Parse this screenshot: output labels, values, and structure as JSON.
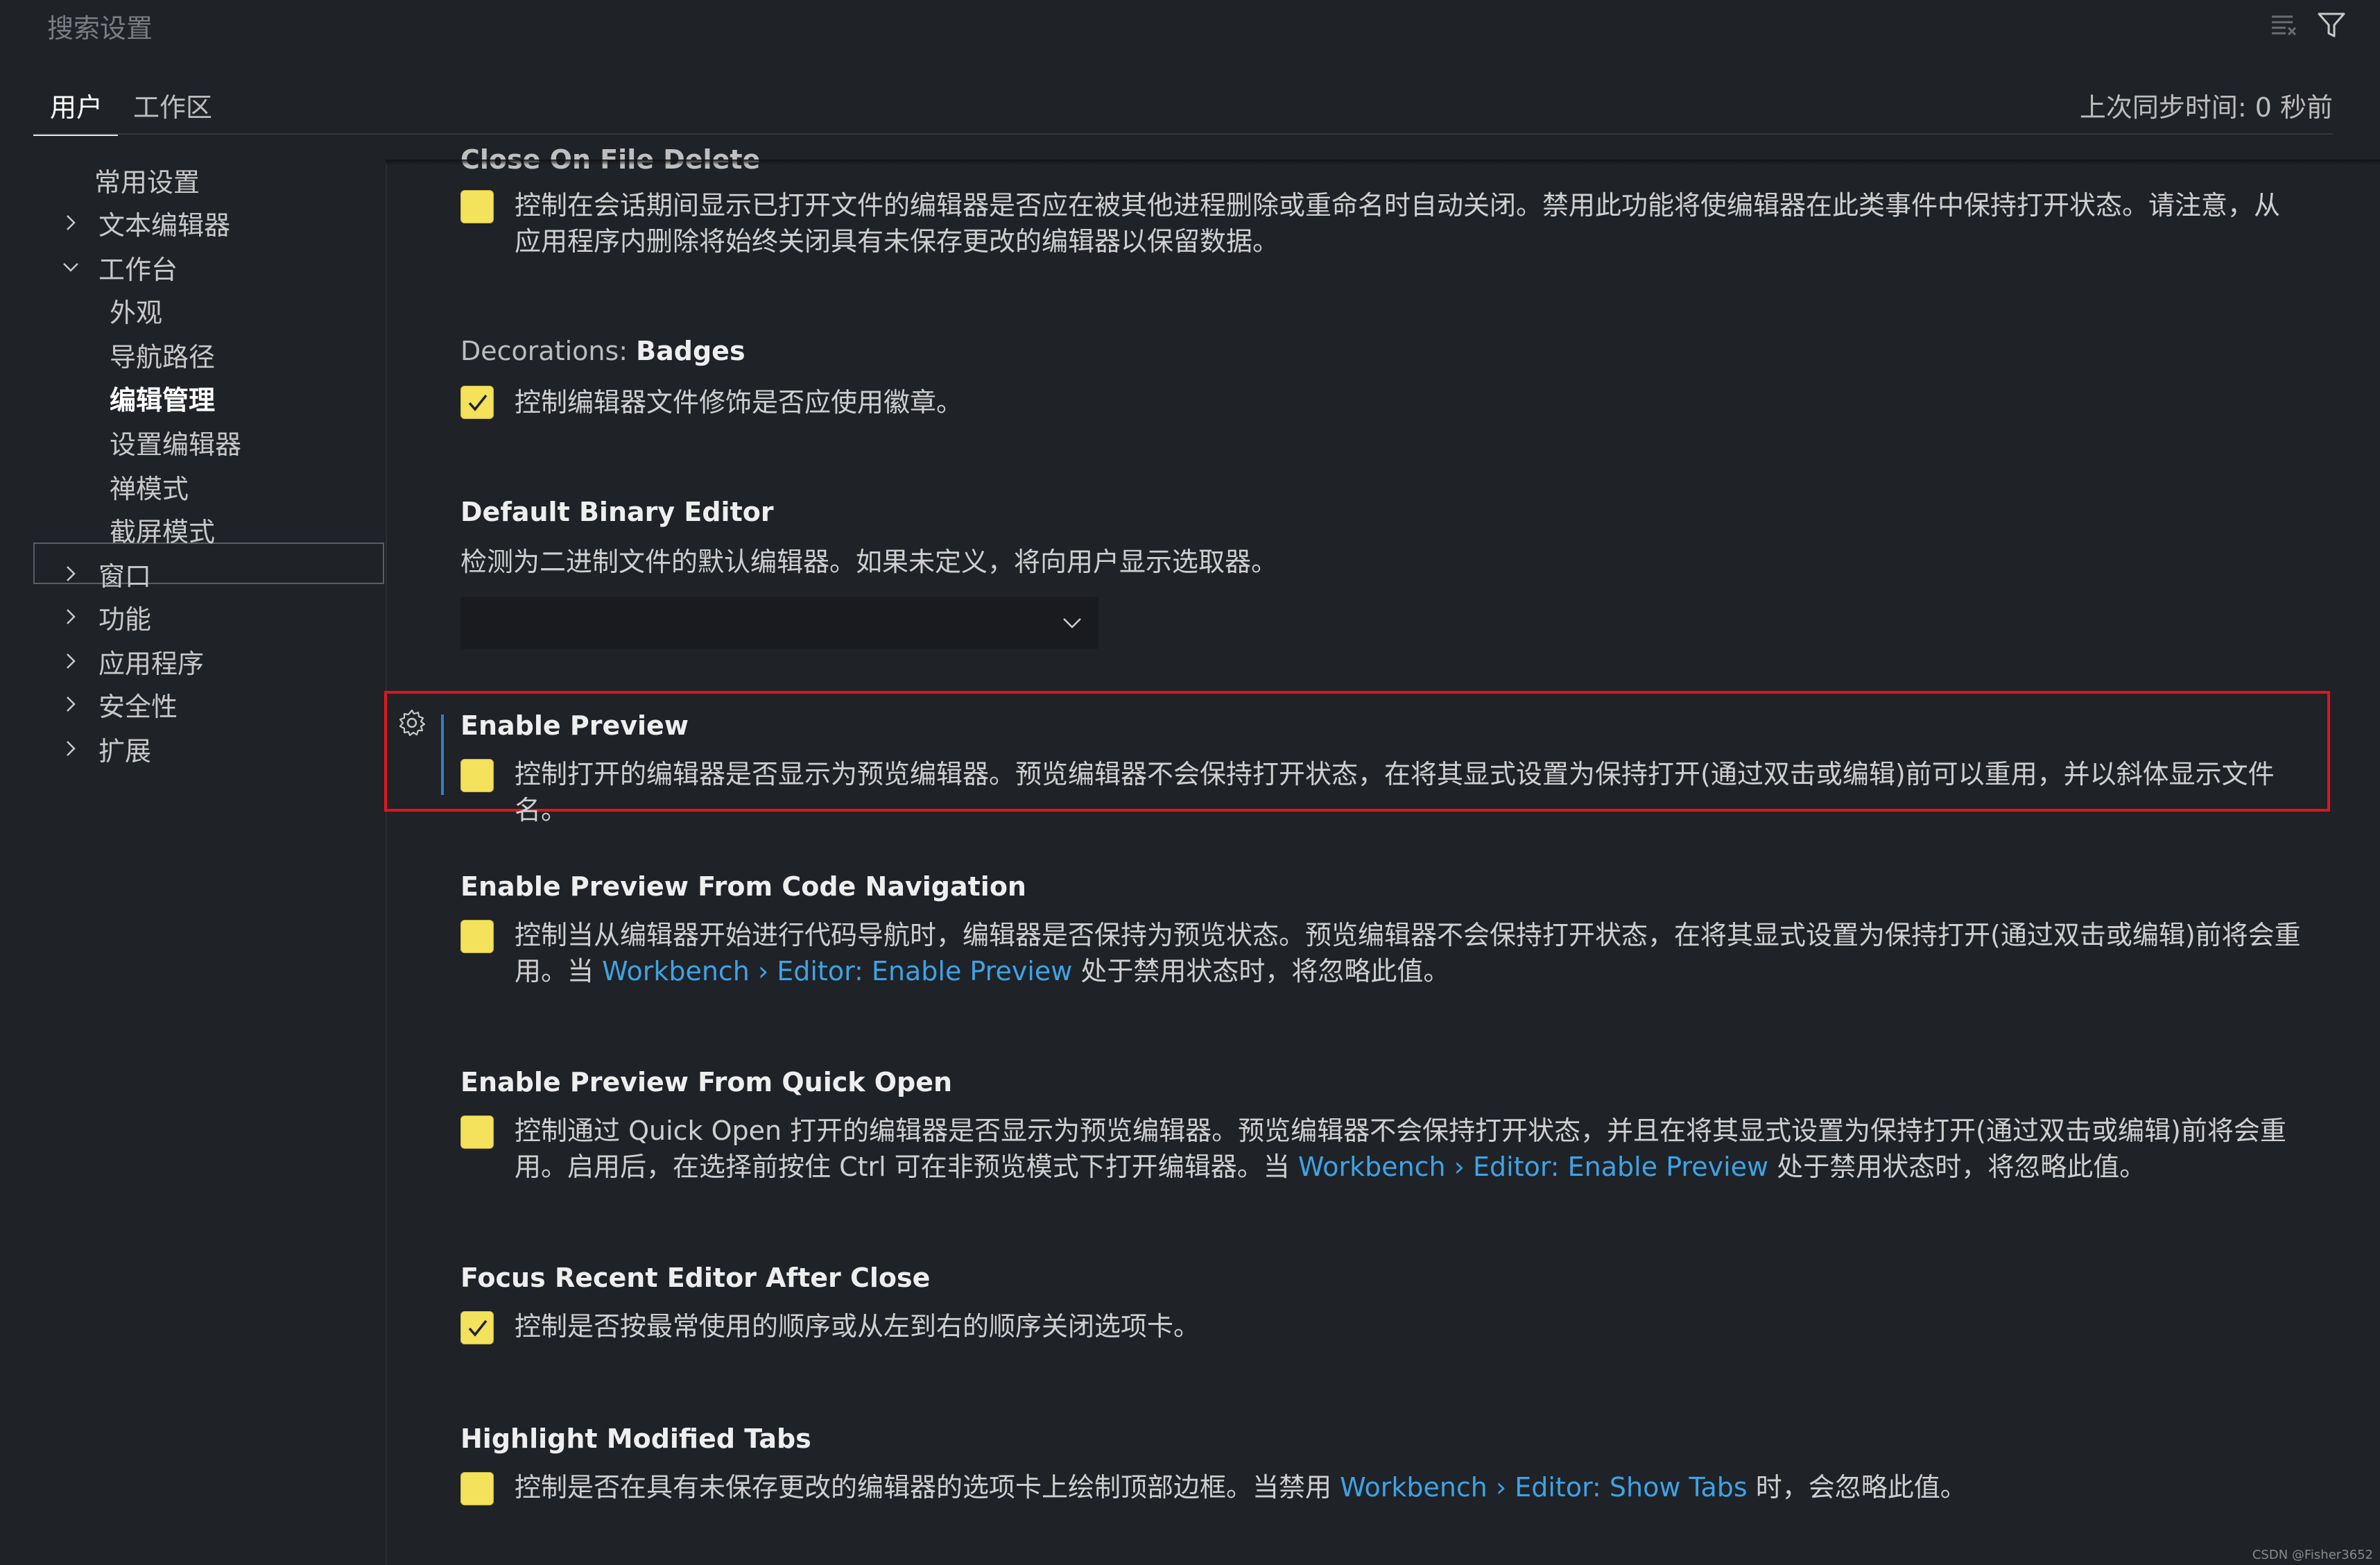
{
  "search": {
    "placeholder": "搜索设置"
  },
  "tabs": [
    {
      "label": "用户"
    },
    {
      "label": "工作区"
    }
  ],
  "sync": {
    "text": "上次同步时间: 0 秒前"
  },
  "sidebar": {
    "items": [
      {
        "label": "常用设置"
      },
      {
        "label": "文本编辑器"
      },
      {
        "label": "工作台"
      },
      {
        "label": "外观"
      },
      {
        "label": "导航路径"
      },
      {
        "label": "编辑管理"
      },
      {
        "label": "设置编辑器"
      },
      {
        "label": "禅模式"
      },
      {
        "label": "截屏模式"
      },
      {
        "label": "窗口"
      },
      {
        "label": "功能"
      },
      {
        "label": "应用程序"
      },
      {
        "label": "安全性"
      },
      {
        "label": "扩展"
      }
    ]
  },
  "settings": {
    "close_on_file_delete": {
      "title": "Close On File Delete",
      "desc": "控制在会话期间显示已打开文件的编辑器是否应在被其他进程删除或重命名时自动关闭。禁用此功能将使编辑器在此类事件中保持打开状态。请注意，从应用程序内删除将始终关闭具有未保存更改的编辑器以保留数据。",
      "checked": false
    },
    "decorations_badges": {
      "category": "Decorations: ",
      "key": "Badges",
      "desc": "控制编辑器文件修饰是否应使用徽章。",
      "checked": true
    },
    "default_binary_editor": {
      "title": "Default Binary Editor",
      "desc": "检测为二进制文件的默认编辑器。如果未定义，将向用户显示选取器。",
      "value": ""
    },
    "enable_preview": {
      "title": "Enable Preview",
      "desc": "控制打开的编辑器是否显示为预览编辑器。预览编辑器不会保持打开状态，在将其显式设置为保持打开(通过双击或编辑)前可以重用，并以斜体显示文件名。",
      "checked": false
    },
    "enable_preview_code_nav": {
      "title": "Enable Preview From Code Navigation",
      "desc_a": "控制当从编辑器开始进行代码导航时，编辑器是否保持为预览状态。预览编辑器不会保持打开状态，在将其显式设置为保持打开(通过双击或编辑)前将会重用。当 ",
      "link": "Workbench › Editor: Enable Preview",
      "desc_b": " 处于禁用状态时，将忽略此值。",
      "checked": false
    },
    "enable_preview_quick_open": {
      "title": "Enable Preview From Quick Open",
      "desc_a": "控制通过 Quick Open 打开的编辑器是否显示为预览编辑器。预览编辑器不会保持打开状态，并且在将其显式设置为保持打开(通过双击或编辑)前将会重用。启用后，在选择前按住 Ctrl 可在非预览模式下打开编辑器。当 ",
      "link": "Workbench › Editor: Enable Preview",
      "desc_b": " 处于禁用状态时，将忽略此值。",
      "checked": false
    },
    "focus_recent_editor": {
      "title": "Focus Recent Editor After Close",
      "desc": "控制是否按最常使用的顺序或从左到右的顺序关闭选项卡。",
      "checked": true
    },
    "highlight_modified_tabs": {
      "title": "Highlight Modified Tabs",
      "desc_a": "控制是否在具有未保存更改的编辑器的选项卡上绘制顶部边框。当禁用 ",
      "link": "Workbench › Editor: Show Tabs",
      "desc_b": " 时，会忽略此值。",
      "checked": false
    }
  },
  "watermark": "CSDN @Fisher3652",
  "colors": {
    "checkbox": "#f4e15c",
    "link": "#3ea3e6",
    "highlight": "#e0141e"
  }
}
